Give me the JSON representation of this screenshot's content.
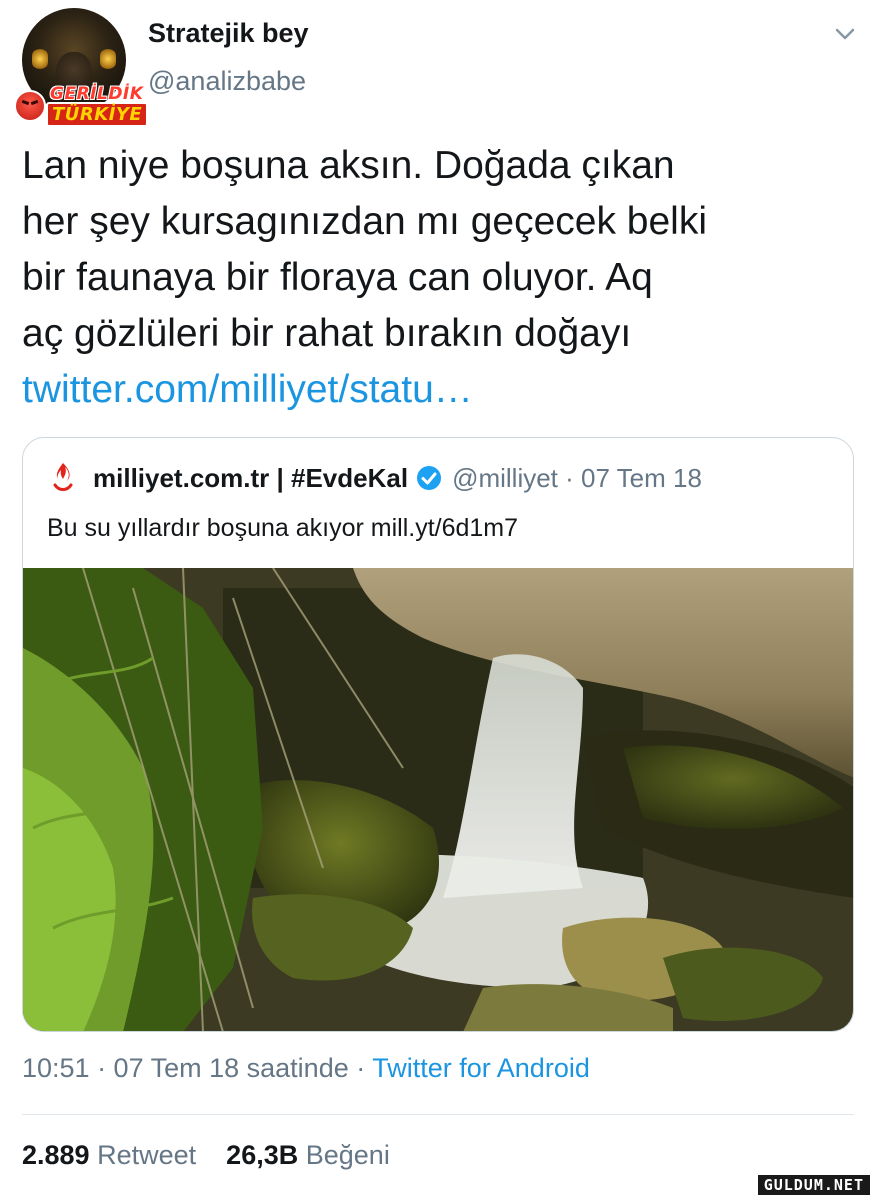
{
  "tweet": {
    "display_name": "Stratejik bey",
    "handle": "@analizbabe",
    "avatar_badge_top": "GERİLDİK",
    "avatar_badge_bottom": "TÜRKİYE",
    "text_lines": [
      "Lan niye boşuna aksın. Doğada çıkan",
      "her şey kursagınızdan mı geçecek belki",
      "bir faunaya bir floraya can oluyor. Aq",
      "aç gözlüleri bir rahat bırakın doğayı"
    ],
    "link_text": "twitter.com/milliyet/statu…",
    "quoted": {
      "name": "milliyet.com.tr | #EvdeKal",
      "handle_date": "@milliyet · 07 Tem 18",
      "text": "Bu su yıllardır boşuna akıyor mill.yt/6d1m7",
      "image_icon": "waterfall-photo"
    },
    "meta": {
      "time_date": "10:51 · 07 Tem 18 saatinde · ",
      "source": "Twitter for Android"
    },
    "stats": {
      "retweets": "2.889",
      "retweets_label": "Retweet",
      "likes": "26,3B",
      "likes_label": "Beğeni"
    }
  },
  "watermark": "GULDUM.NET",
  "colors": {
    "link": "#1b95e0",
    "secondary": "#657786",
    "border": "#ccd6dd",
    "verified": "#1da1f2"
  }
}
